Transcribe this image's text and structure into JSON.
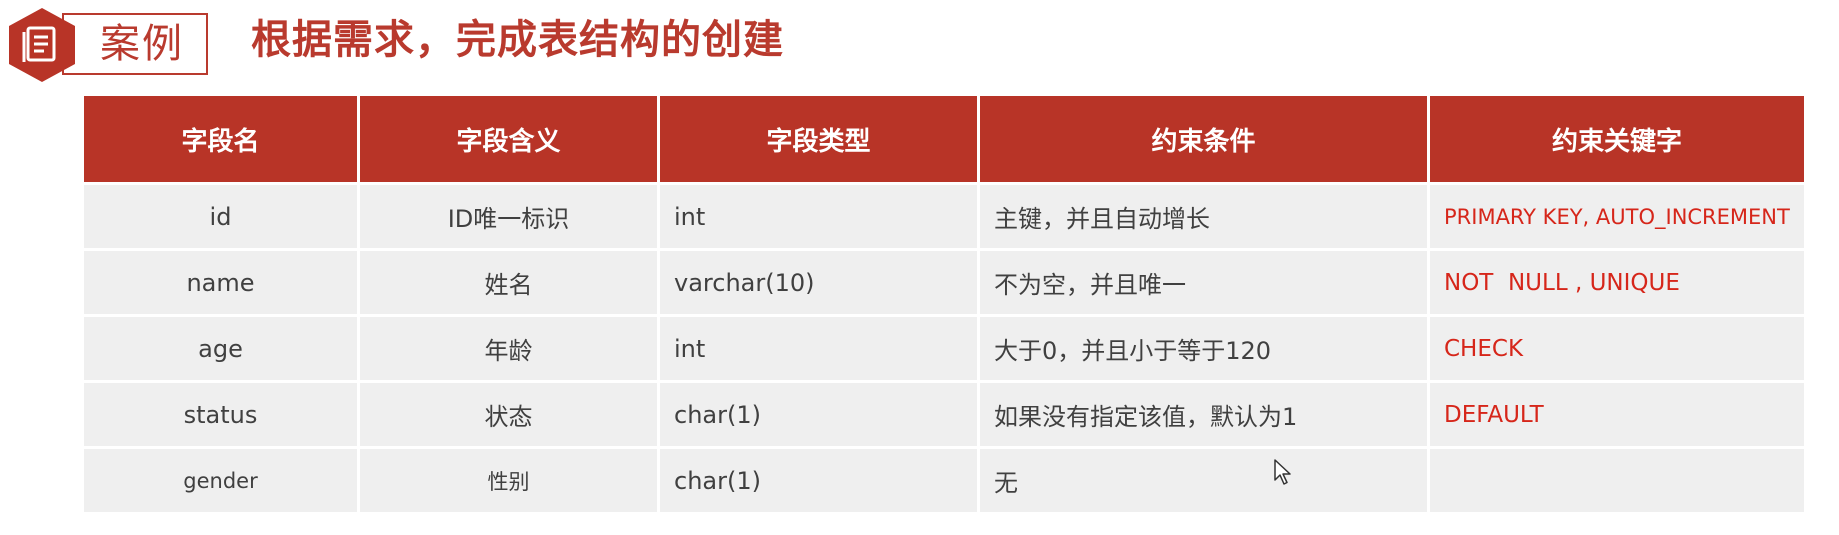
{
  "header": {
    "case_label": "案例",
    "title": "根据需求，完成表结构的创建"
  },
  "icons": {
    "case_icon": "document-hexagon-icon",
    "cursor": "mouse-pointer-icon"
  },
  "colors": {
    "accent": "#b83427",
    "keyword": "#d6261a",
    "row_bg": "#efefef"
  },
  "table": {
    "columns": [
      "字段名",
      "字段含义",
      "字段类型",
      "约束条件",
      "约束关键字"
    ],
    "rows": [
      [
        "id",
        "ID唯一标识",
        "int",
        "主键，并且自动增长",
        "PRIMARY KEY, AUTO_INCREMENT"
      ],
      [
        "name",
        "姓名",
        "varchar(10)",
        "不为空，并且唯一",
        "NOT  NULL , UNIQUE"
      ],
      [
        "age",
        "年龄",
        "int",
        "大于0，并且小于等于120",
        "CHECK"
      ],
      [
        "status",
        "状态",
        "char(1)",
        "如果没有指定该值，默认为1",
        "DEFAULT"
      ],
      [
        "gender",
        "性别",
        "char(1)",
        "无",
        ""
      ]
    ]
  }
}
